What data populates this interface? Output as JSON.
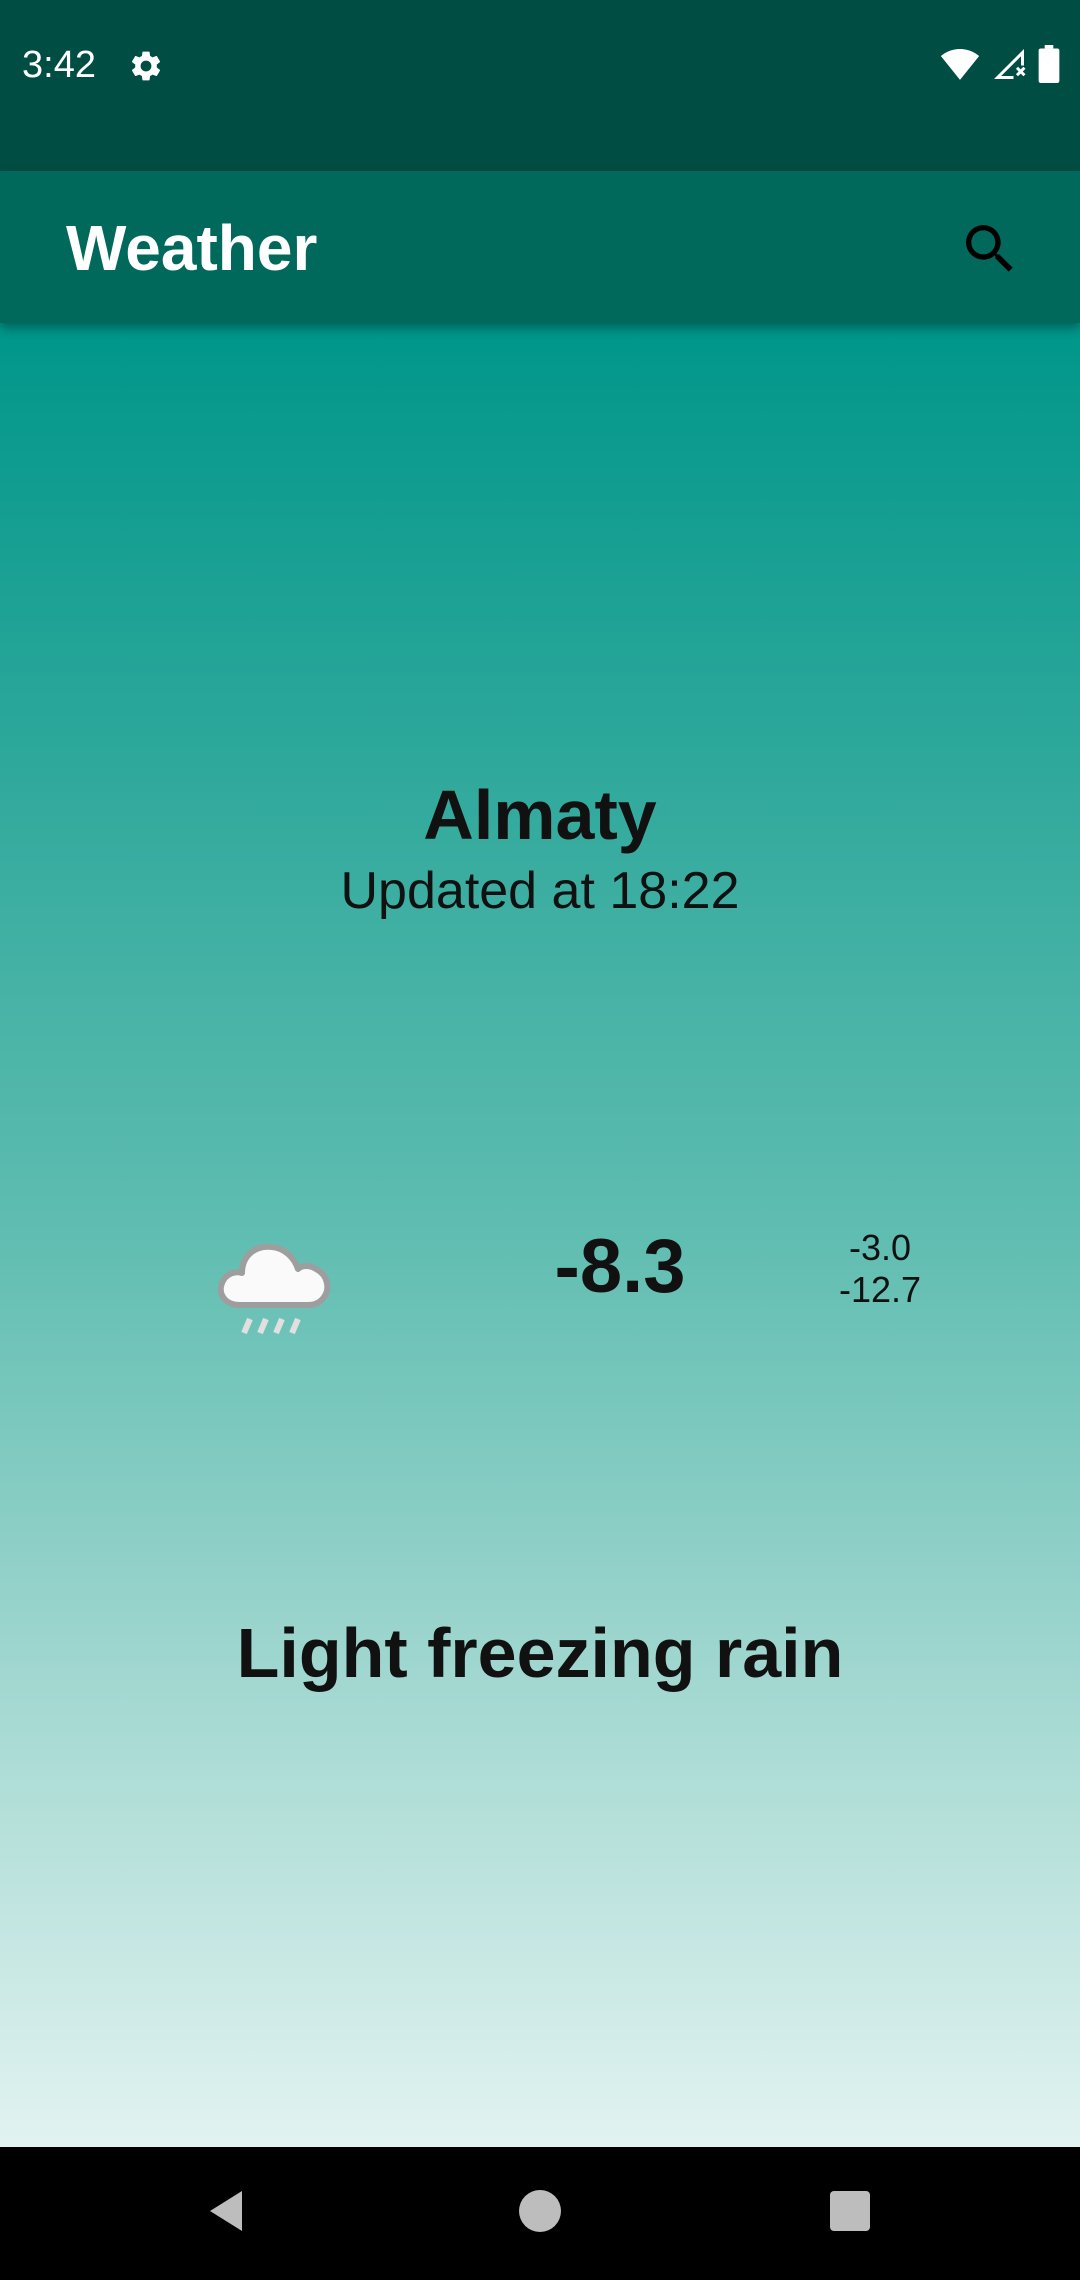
{
  "status_bar": {
    "time": "3:42",
    "icons": [
      "settings-gear-icon",
      "wifi-icon",
      "cell-signal-no-service-icon",
      "battery-icon"
    ]
  },
  "app_bar": {
    "title": "Weather",
    "search_icon": "search-icon"
  },
  "weather": {
    "city": "Almaty",
    "updated": "Updated at 18:22",
    "icon": "freezing-rain-cloud-icon",
    "temperature": "-8.3",
    "temp_max": "-3.0",
    "temp_min": "-12.7",
    "description": "Light freezing rain"
  },
  "nav_bar": {
    "buttons": [
      "back-icon",
      "home-icon",
      "recents-icon"
    ]
  },
  "colors": {
    "status_bar": "#004d44",
    "app_bar": "#00695c",
    "gradient_top": "#00968a",
    "gradient_bottom": "#e2f3f1"
  }
}
